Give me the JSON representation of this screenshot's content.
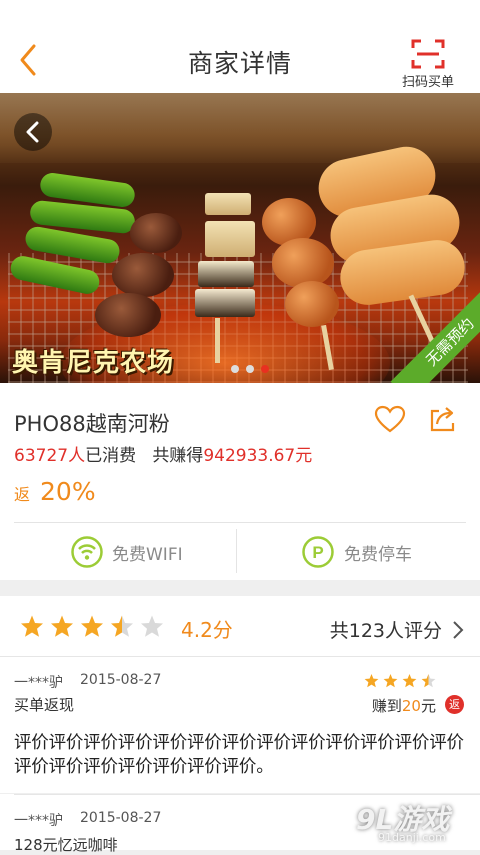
{
  "header": {
    "title": "商家详情",
    "back_icon": "chevron-left-icon",
    "scan_label": "扫码买单",
    "scan_icon": "scan-icon",
    "accent_color": "#f08a1c",
    "scan_color": "#e0302a"
  },
  "banner": {
    "overlay_title": "奥肯尼克农场",
    "ribbon": "无需预约",
    "slide_count": 3,
    "active_slide": 3
  },
  "shop": {
    "name": "PHO88越南河粉",
    "consumers": "63727人",
    "consumers_suffix": "已消费",
    "earned_label": "共赚得",
    "earned_value": "942933.67元",
    "rebate_label": "返",
    "rebate_value": "20%",
    "amenities": [
      {
        "label": "免费WIFI",
        "icon": "wifi-icon"
      },
      {
        "label": "免费停车",
        "icon": "parking-icon"
      }
    ]
  },
  "rating": {
    "stars": 3.5,
    "score": "4.2分",
    "count_label": "共123人评分"
  },
  "reviews": [
    {
      "user": "一***驴",
      "date": "2015-08-27",
      "type": "买单返现",
      "stars": 3.5,
      "earn_label": "赚到",
      "earn_amount": "20",
      "earn_unit": "元",
      "badge": "返",
      "text": "评价评价评价评价评价评价评价评价评价评价评价评价评价评价评价评价评价评价评价评价。"
    },
    {
      "user": "一***驴",
      "date": "2015-08-27",
      "type": "128元忆远咖啡"
    }
  ],
  "watermark": {
    "logo": "9L游戏",
    "url": "91danji.com"
  }
}
